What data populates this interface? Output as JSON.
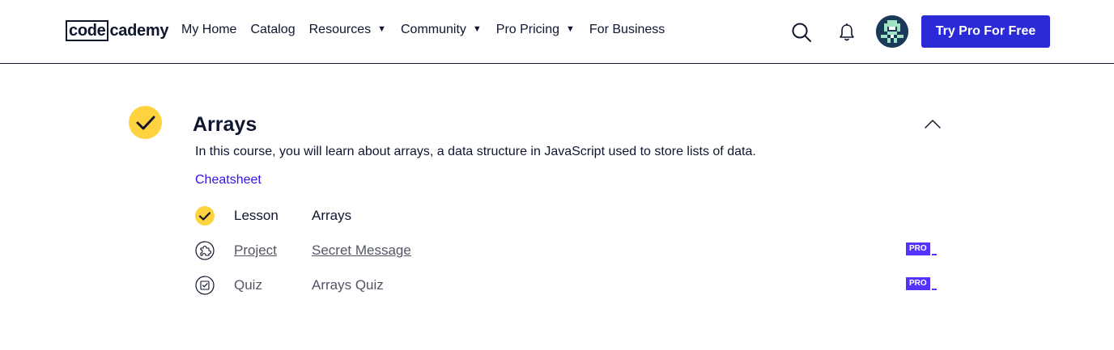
{
  "header": {
    "logo_boxed": "code",
    "logo_rest": "cademy",
    "nav": [
      {
        "label": "My Home",
        "dropdown": false
      },
      {
        "label": "Catalog",
        "dropdown": false
      },
      {
        "label": "Resources",
        "dropdown": true
      },
      {
        "label": "Community",
        "dropdown": true
      },
      {
        "label": "Pro Pricing",
        "dropdown": true
      },
      {
        "label": "For Business",
        "dropdown": false
      }
    ],
    "caret": "▼",
    "cta_label": "Try Pro For Free"
  },
  "module": {
    "title": "Arrays",
    "description": "In this course, you will learn about arrays, a data structure in JavaScript used to store lists of data.",
    "cheatsheet_label": "Cheatsheet",
    "items": [
      {
        "type": "Lesson",
        "name": "Arrays",
        "status_icon": "check-icon",
        "pro": false
      },
      {
        "type": "Project",
        "name": "Secret Message",
        "status_icon": "puzzle-icon",
        "pro": true
      },
      {
        "type": "Quiz",
        "name": "Arrays Quiz",
        "status_icon": "quiz-icon",
        "pro": true
      }
    ],
    "pro_label": "PRO"
  },
  "colors": {
    "accent": "#2a2ad7",
    "complete": "#ffd23f",
    "link": "#3a10e5",
    "pro": "#5533ff",
    "text": "#10162f"
  }
}
